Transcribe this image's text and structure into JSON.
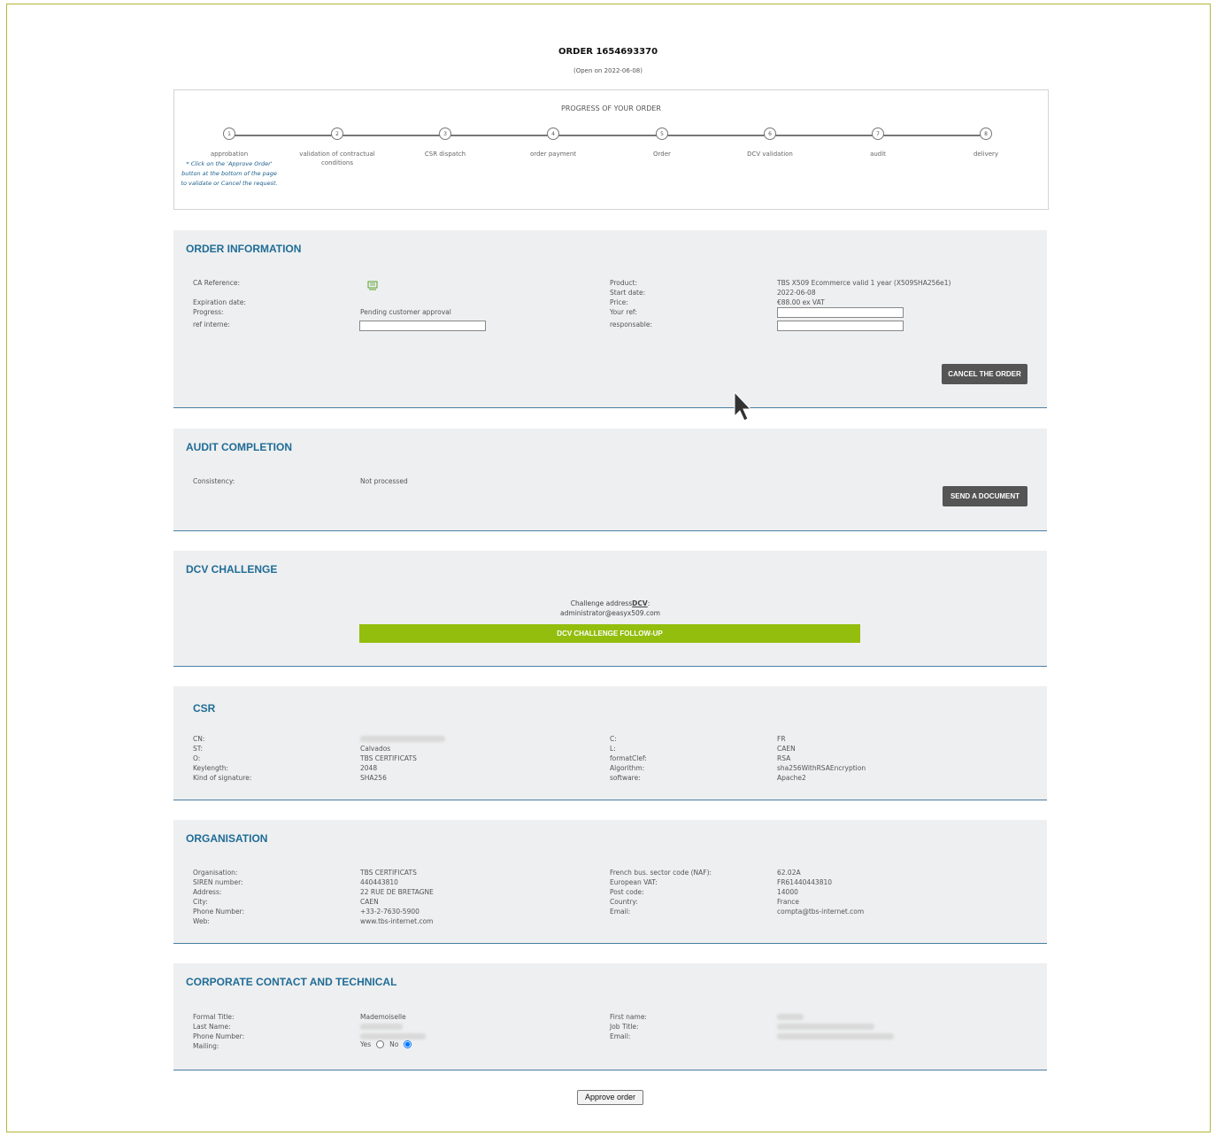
{
  "header": {
    "title": "ORDER 1654693370",
    "subtitle": "(Open on 2022-06-08)"
  },
  "progress": {
    "title": "PROGRESS OF YOUR ORDER",
    "steps": [
      {
        "num": "1",
        "label": "approbation"
      },
      {
        "num": "2",
        "label": "validation of contractual conditions"
      },
      {
        "num": "3",
        "label": "CSR dispatch"
      },
      {
        "num": "4",
        "label": "order payment"
      },
      {
        "num": "5",
        "label": "Order"
      },
      {
        "num": "6",
        "label": "DCV validation"
      },
      {
        "num": "7",
        "label": "audit"
      },
      {
        "num": "8",
        "label": "delivery"
      }
    ],
    "note": "* Click on the 'Approve Order' button at the bottom of the page to validate or Cancel the request."
  },
  "order_info": {
    "title": "ORDER INFORMATION",
    "ca_reference_label": "CA Reference:",
    "ca_reference_icon": "certificate-icon",
    "expiration_label": "Expiration date:",
    "progress_label": "Progress:",
    "progress_value": "Pending customer approval",
    "ref_interne_label": "ref interne:",
    "product_label": "Product:",
    "product_value": "TBS X509 Ecommerce valid 1 year (X509SHA256e1)",
    "start_label": "Start date:",
    "start_value": "2022-06-08",
    "price_label": "Price:",
    "price_value": "€88.00 ex VAT",
    "your_ref_label": "Your ref:",
    "responsable_label": "responsable:",
    "cancel_button": "CANCEL THE ORDER"
  },
  "audit": {
    "title": "AUDIT COMPLETION",
    "consistency_label": "Consistency:",
    "consistency_value": "Not processed",
    "send_button": "SEND A DOCUMENT"
  },
  "dcv": {
    "title": "DCV CHALLENGE",
    "address_label": "Challenge address",
    "address_abbr": "DCV",
    "address_colon": ":",
    "email": "administrator@easyx509.com",
    "followup_button": "DCV CHALLENGE FOLLOW-UP"
  },
  "csr": {
    "title": "CSR",
    "left": [
      {
        "label": "CN:",
        "value": ""
      },
      {
        "label": "ST:",
        "value": "Calvados"
      },
      {
        "label": "O:",
        "value": "TBS CERTIFICATS"
      },
      {
        "label": "Keylength:",
        "value": "2048"
      },
      {
        "label": "Kind of signature:",
        "value": "SHA256"
      }
    ],
    "right": [
      {
        "label": "C:",
        "value": "FR"
      },
      {
        "label": "L:",
        "value": "CAEN"
      },
      {
        "label": "formatClef:",
        "value": "RSA"
      },
      {
        "label": "Algorithm:",
        "value": "sha256WithRSAEncryption"
      },
      {
        "label": "software:",
        "value": "Apache2"
      }
    ]
  },
  "organisation": {
    "title": "ORGANISATION",
    "left": [
      {
        "label": "Organisation:",
        "value": "TBS CERTIFICATS"
      },
      {
        "label": "SIREN number:",
        "value": "440443810"
      },
      {
        "label": "Address:",
        "value": "22 RUE DE BRETAGNE"
      },
      {
        "label": "City:",
        "value": "CAEN"
      },
      {
        "label": "Phone Number:",
        "value": "+33-2-7630-5900"
      },
      {
        "label": "Web:",
        "value": "www.tbs-internet.com"
      }
    ],
    "right": [
      {
        "label": "French bus. sector code (NAF):",
        "value": "62.02A"
      },
      {
        "label": "European VAT:",
        "value": "FR61440443810"
      },
      {
        "label": "Post code:",
        "value": "14000"
      },
      {
        "label": "Country:",
        "value": "France"
      },
      {
        "label": "Email:",
        "value": "compta@tbs-internet.com"
      }
    ]
  },
  "contact": {
    "title": "CORPORATE CONTACT AND TECHNICAL",
    "formal_title_label": "Formal Title:",
    "formal_title_value": "Mademoiselle",
    "last_name_label": "Last Name:",
    "phone_label": "Phone Number:",
    "mailing_label": "Mailing:",
    "yes_label": "Yes",
    "no_label": "No",
    "first_name_label": "First name:",
    "job_title_label": "Job Title:",
    "email_label": "Email:"
  },
  "approve_button": "Approve order"
}
